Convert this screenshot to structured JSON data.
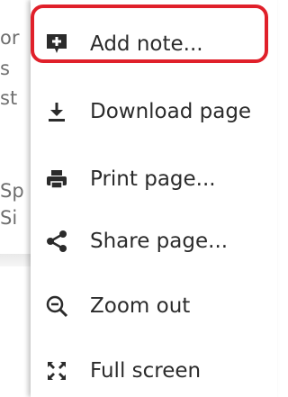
{
  "background_page": {
    "fragments": [
      "or",
      "s",
      "st",
      "Sp",
      "Si"
    ]
  },
  "menu": {
    "items": [
      {
        "label": "Add note...",
        "icon": "add-note-icon"
      },
      {
        "label": "Download page",
        "icon": "download-icon"
      },
      {
        "label": "Print page...",
        "icon": "print-icon"
      },
      {
        "label": "Share page...",
        "icon": "share-icon"
      },
      {
        "label": "Zoom out",
        "icon": "zoom-out-icon"
      },
      {
        "label": "Full screen",
        "icon": "full-screen-icon"
      }
    ],
    "highlight_color": "#e0202a",
    "icon_color": "#2b2b2b"
  }
}
